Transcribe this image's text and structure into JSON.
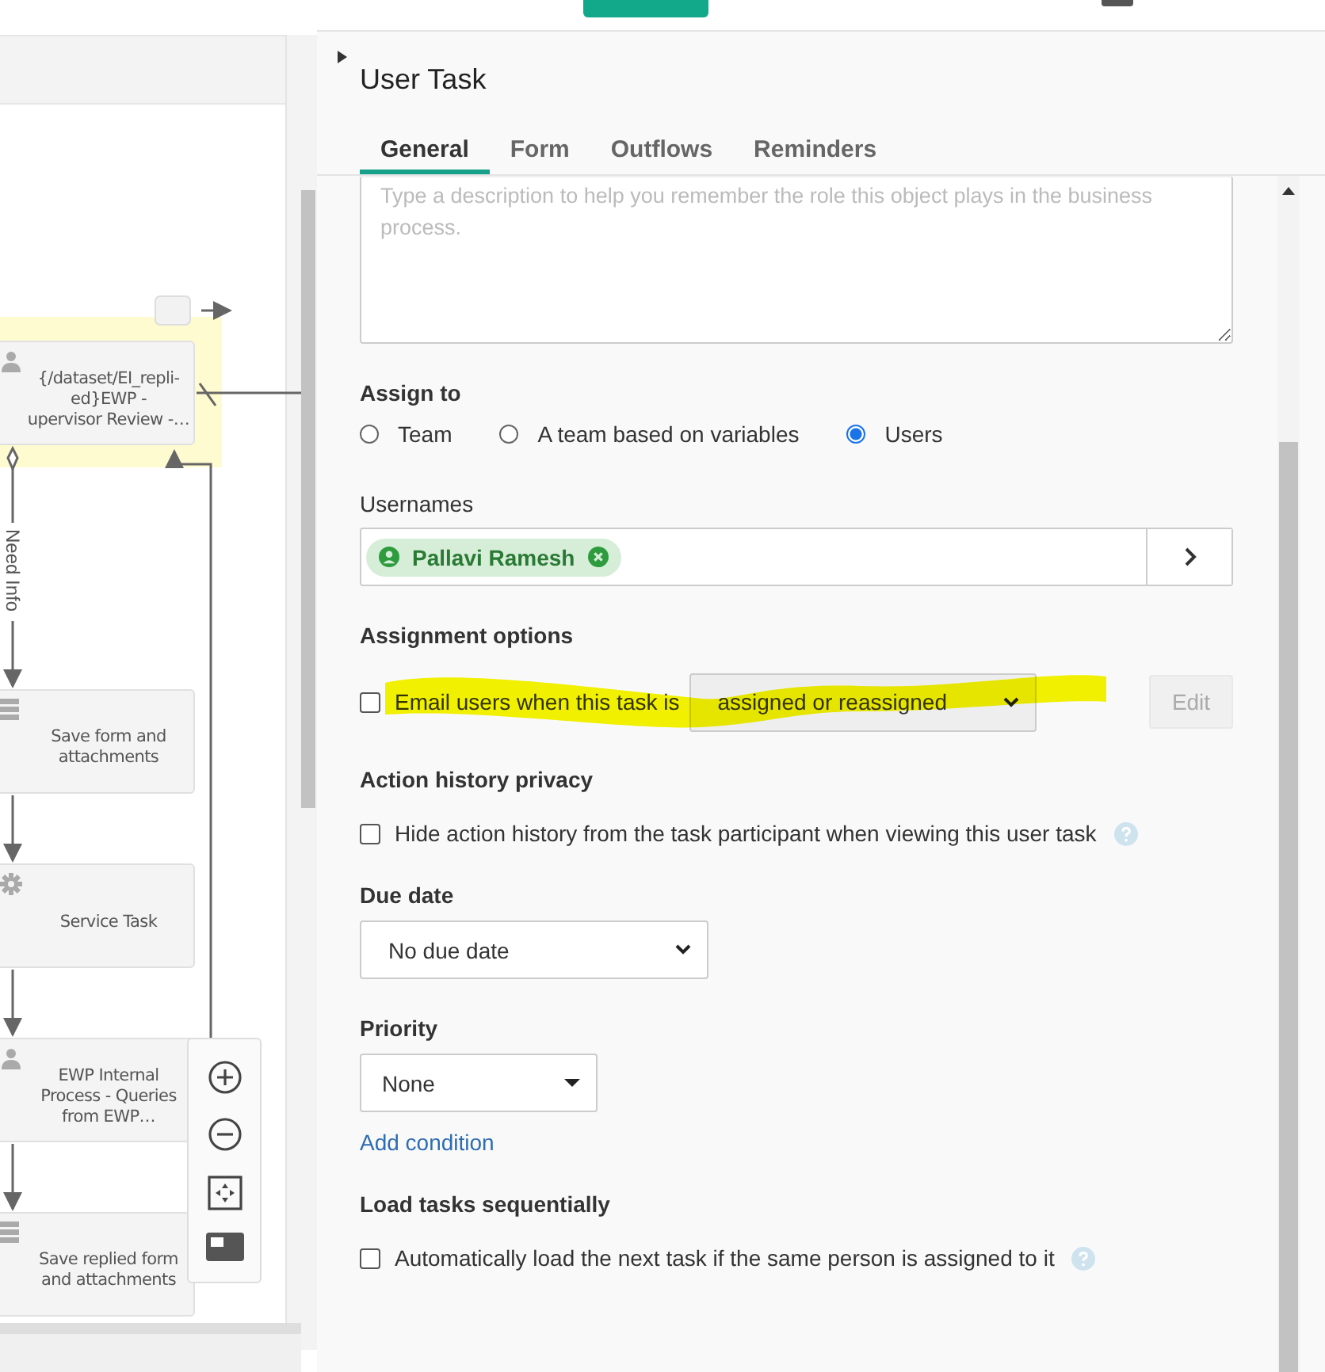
{
  "diagram": {
    "nodes": [
      {
        "kind": "user",
        "label_lines": [
          "{/dataset/EI_repli-",
          "ed}EWP -",
          "upervisor Review -…"
        ],
        "highlighted": true
      },
      {
        "kind": "script",
        "label_lines": [
          "Save form and",
          "attachments"
        ],
        "highlighted": false
      },
      {
        "kind": "service",
        "label_lines": [
          "Service Task"
        ],
        "highlighted": false
      },
      {
        "kind": "user",
        "label_lines": [
          "EWP Internal",
          "Process - Queries",
          "from EWP…"
        ],
        "highlighted": false
      },
      {
        "kind": "script",
        "label_lines": [
          "Save replied form",
          "and attachments"
        ],
        "highlighted": false
      }
    ],
    "edge_label": "Need Info"
  },
  "panel": {
    "title": "User Task",
    "tabs": [
      {
        "label": "General",
        "selected": true
      },
      {
        "label": "Form",
        "selected": false
      },
      {
        "label": "Outflows",
        "selected": false
      },
      {
        "label": "Reminders",
        "selected": false
      }
    ]
  },
  "description": {
    "placeholder": "Type a description to help you remember the role this object plays in the business process."
  },
  "assign_to": {
    "label": "Assign to",
    "options": [
      {
        "label": "Team",
        "selected": false
      },
      {
        "label": "A team based on variables",
        "selected": false
      },
      {
        "label": "Users",
        "selected": true
      }
    ]
  },
  "usernames": {
    "label": "Usernames",
    "chips": [
      {
        "name": "Pallavi Ramesh"
      }
    ]
  },
  "assignment_options": {
    "label": "Assignment options",
    "email": {
      "label": "Email users when this task is",
      "checked": false,
      "value": "assigned or reassigned"
    },
    "edit_button": {
      "label": "Edit",
      "disabled": true
    }
  },
  "action_history": {
    "label": "Action history privacy",
    "option": {
      "label": "Hide action history from the task participant when viewing this user task",
      "checked": false
    }
  },
  "due_date": {
    "label": "Due date",
    "value": "No due date"
  },
  "priority": {
    "label": "Priority",
    "value": "None",
    "link": "Add condition"
  },
  "load_tasks": {
    "label": "Load tasks sequentially",
    "option": {
      "label": "Automatically load the next task if the same person is assigned to it",
      "checked": false
    }
  }
}
